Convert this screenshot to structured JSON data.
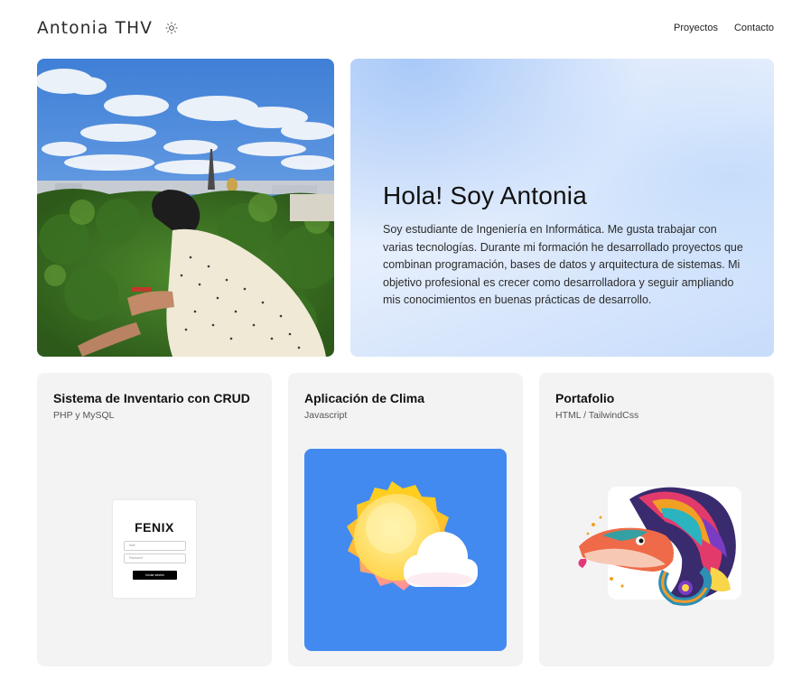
{
  "header": {
    "logo": "Antonia THV",
    "theme_icon": "sun-icon",
    "nav": [
      {
        "label": "Proyectos"
      },
      {
        "label": "Contacto"
      }
    ]
  },
  "intro": {
    "title": "Hola! Soy Antonia",
    "text": "Soy estudiante de Ingeniería en Informática. Me gusta trabajar con varias tecnologías. Durante mi formación he desarrollado proyectos que combinan programación, bases de datos y arquitectura de sistemas. Mi objetivo profesional es crecer como desarrolladora y seguir ampliando mis conocimientos en buenas prácticas de desarrollo."
  },
  "projects": [
    {
      "title": "Sistema de Inventario con CRUD",
      "subtitle": "PHP y MySQL",
      "preview": {
        "brand": "FENIX",
        "field1": "Mail",
        "field2": "Password",
        "button": "Iniciar sesión"
      }
    },
    {
      "title": "Aplicación de Clima",
      "subtitle": "Javascript"
    },
    {
      "title": "Portafolio",
      "subtitle": "HTML / TailwindCss"
    }
  ],
  "colors": {
    "weather_bg": "#428af0",
    "card_bg": "#f3f3f3",
    "intro_gradient": "#dbe8fc"
  }
}
